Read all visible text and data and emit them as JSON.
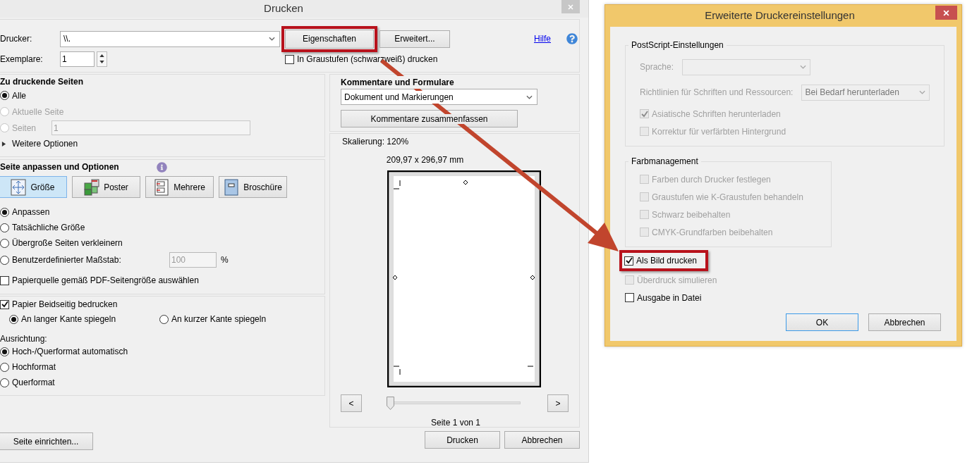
{
  "window": {
    "title": "Drucken"
  },
  "printer": {
    "label": "Drucker:",
    "value": "\\\\."
  },
  "copies": {
    "label": "Exemplare:",
    "value": "1"
  },
  "top_buttons": [
    {
      "label": "Eigenschaften",
      "highlighted": true
    },
    {
      "label": "Erweitert...",
      "highlighted": false
    }
  ],
  "help": {
    "label": "Hilfe"
  },
  "grayscale": {
    "label": "In Graustufen (schwarzweiß) drucken",
    "checked": false
  },
  "pages": {
    "title": "Zu druckende Seiten",
    "options": [
      {
        "label": "Alle",
        "selected": true,
        "disabled": false
      },
      {
        "label": "Aktuelle Seite",
        "selected": false,
        "disabled": true
      },
      {
        "label": "Seiten",
        "selected": false,
        "disabled": true,
        "field": "1"
      }
    ],
    "more": {
      "label": "Weitere Optionen",
      "expanded": false
    }
  },
  "sizing": {
    "title": "Seite anpassen und Optionen",
    "modes": [
      {
        "label": "Größe",
        "selected": true
      },
      {
        "label": "Poster",
        "selected": false
      },
      {
        "label": "Mehrere",
        "selected": false
      },
      {
        "label": "Broschüre",
        "selected": false
      }
    ],
    "scaling": [
      {
        "label": "Anpassen",
        "selected": true
      },
      {
        "label": "Tatsächliche Größe",
        "selected": false
      },
      {
        "label": "Übergroße Seiten verkleinern",
        "selected": false
      },
      {
        "label": "Benutzerdefinierter Maßstab:",
        "selected": false,
        "field": "100",
        "unit": "%"
      }
    ],
    "paper_source": {
      "label": "Papierquelle gemäß PDF-Seitengröße auswählen",
      "checked": false
    }
  },
  "duplex": {
    "label": "Papier Beidseitig bedrucken",
    "checked": true,
    "options": [
      {
        "label": "An langer Kante spiegeln",
        "selected": true
      },
      {
        "label": "An kurzer Kante spiegeln",
        "selected": false
      }
    ]
  },
  "orientation": {
    "title": "Ausrichtung:",
    "options": [
      {
        "label": "Hoch-/Querformat automatisch",
        "selected": true
      },
      {
        "label": "Hochformat",
        "selected": false
      },
      {
        "label": "Querformat",
        "selected": false
      }
    ]
  },
  "page_setup_button": "Seite einrichten...",
  "comments": {
    "title": "Kommentare und Formulare",
    "value": "Dokument und Markierungen",
    "button": "Kommentare zusammenfassen"
  },
  "preview": {
    "scaling": "Skalierung: 120%",
    "size": "209,97 x 296,97 mm",
    "prev": "<",
    "next": ">",
    "slider": {
      "level": 0
    },
    "page_info": "Seite 1 von 1"
  },
  "actions": [
    {
      "label": "Drucken"
    },
    {
      "label": "Abbrechen"
    }
  ],
  "advanced": {
    "title": "Erweiterte Druckereinstellungen",
    "groups": [
      {
        "title": "PostScript-Einstellungen",
        "items": [
          {
            "kind": "select",
            "label": "Sprache:",
            "disabled": true
          },
          {
            "kind": "select",
            "label": "Richtlinien für Schriften und Ressourcen:",
            "value": "Bei Bedarf herunterladen",
            "disabled": true
          },
          {
            "kind": "checkbox",
            "label": "Asiatische Schriften herunterladen",
            "checked": true,
            "disabled": true
          },
          {
            "kind": "checkbox",
            "label": "Korrektur für verfärbten Hintergrund",
            "checked": false,
            "disabled": true
          }
        ]
      },
      {
        "title": "Farbmanagement",
        "items": [
          {
            "kind": "checkbox",
            "label": "Farben durch Drucker festlegen",
            "checked": false,
            "disabled": true
          },
          {
            "kind": "checkbox",
            "label": "Graustufen wie K-Graustufen behandeln",
            "checked": false,
            "disabled": true
          },
          {
            "kind": "checkbox",
            "label": "Schwarz beibehalten",
            "checked": false,
            "disabled": true
          },
          {
            "kind": "checkbox",
            "label": "CMYK-Grundfarben beibehalten",
            "checked": false,
            "disabled": true
          }
        ]
      }
    ],
    "options": [
      {
        "label": "Als Bild drucken",
        "checked": true,
        "disabled": false,
        "highlighted": true
      },
      {
        "label": "Überdruck simulieren",
        "checked": false,
        "disabled": true,
        "highlighted": false
      },
      {
        "label": "Ausgabe in Datei",
        "checked": false,
        "disabled": false,
        "highlighted": false
      }
    ],
    "buttons": [
      {
        "label": "OK",
        "focused": true
      },
      {
        "label": "Abbrechen",
        "focused": false
      }
    ]
  }
}
